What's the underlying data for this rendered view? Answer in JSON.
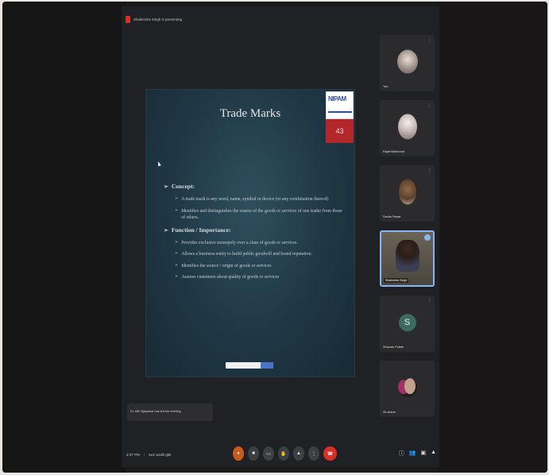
{
  "header": {
    "presenting_text": "Shailendra Singh is presenting"
  },
  "slide": {
    "title": "Trade Marks",
    "logo_text": "NIPAM",
    "slide_number": "43",
    "sections": [
      {
        "heading": "Concept:",
        "items": [
          "A trade mark is any word, name, symbol or device (or any combination thereof)",
          "Identifies and distinguishes the source of the goods or services of one trader from those of others."
        ]
      },
      {
        "heading": "Function / Importance:",
        "items": [
          "Provides exclusive monopoly over a class of goods or services.",
          "Allows a business entity to build public goodwill and brand reputation.",
          "Identifies the source / origin of goods or services",
          "Assures customers about quality of goods or services"
        ]
      }
    ]
  },
  "participants": [
    {
      "name": "You",
      "type": "photo"
    },
    {
      "name": "Rajat Mahmood",
      "type": "photo"
    },
    {
      "name": "Sarika Pawar",
      "type": "photo"
    },
    {
      "name": "Shailendra Singh",
      "type": "video",
      "active": true
    },
    {
      "name": "Shaurav Pulate",
      "type": "letter",
      "initial": "S"
    },
    {
      "name": "30 others",
      "type": "group"
    }
  ],
  "chat_toast": {
    "text": "Dr. MB Vijayarkar has left the meeting"
  },
  "bottom": {
    "time": "2:37 PM",
    "meeting_code": "nwc-wzdk-gbk"
  },
  "colors": {
    "end_call": "#d93025",
    "active_tile_border": "#8ab4f8",
    "slide_number_bg": "#b3262a"
  },
  "icons": [
    "mic-icon",
    "camera-icon",
    "captions-icon",
    "hand-icon",
    "present-icon",
    "more-icon",
    "end-call-icon",
    "info-icon",
    "people-icon",
    "chat-icon",
    "activities-icon"
  ]
}
